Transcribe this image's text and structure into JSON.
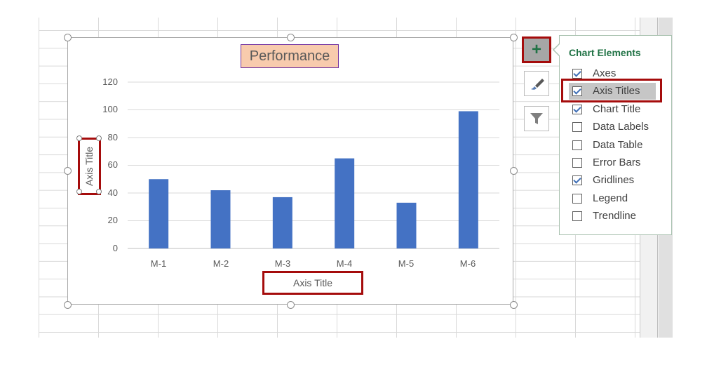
{
  "chart": {
    "title": "Performance",
    "x_axis_title": "Axis Title",
    "y_axis_title": "Axis Title",
    "y_ticks": [
      "120",
      "100",
      "80",
      "60",
      "40",
      "20",
      "0"
    ],
    "bar_color": "#4472c4"
  },
  "chart_data": {
    "type": "bar",
    "title": "Performance",
    "xlabel": "Axis Title",
    "ylabel": "Axis Title",
    "categories": [
      "M-1",
      "M-2",
      "M-3",
      "M-4",
      "M-5",
      "M-6"
    ],
    "values": [
      50,
      42,
      37,
      65,
      33,
      99
    ],
    "ylim": [
      0,
      120
    ],
    "grid": true
  },
  "side_buttons": {
    "plus": {
      "icon": "plus-icon",
      "label": "+"
    },
    "brush": {
      "icon": "paintbrush-icon"
    },
    "filter": {
      "icon": "filter-icon"
    }
  },
  "panel": {
    "title": "Chart Elements",
    "items": [
      {
        "label": "Axes",
        "checked": true
      },
      {
        "label": "Axis Titles",
        "checked": true
      },
      {
        "label": "Chart Title",
        "checked": true
      },
      {
        "label": "Data Labels",
        "checked": false
      },
      {
        "label": "Data Table",
        "checked": false
      },
      {
        "label": "Error Bars",
        "checked": false
      },
      {
        "label": "Gridlines",
        "checked": true
      },
      {
        "label": "Legend",
        "checked": false
      },
      {
        "label": "Trendline",
        "checked": false
      }
    ]
  },
  "colors": {
    "accent_green": "#217346",
    "highlight_red": "#a50c0c",
    "title_fill": "#f8cbad"
  }
}
